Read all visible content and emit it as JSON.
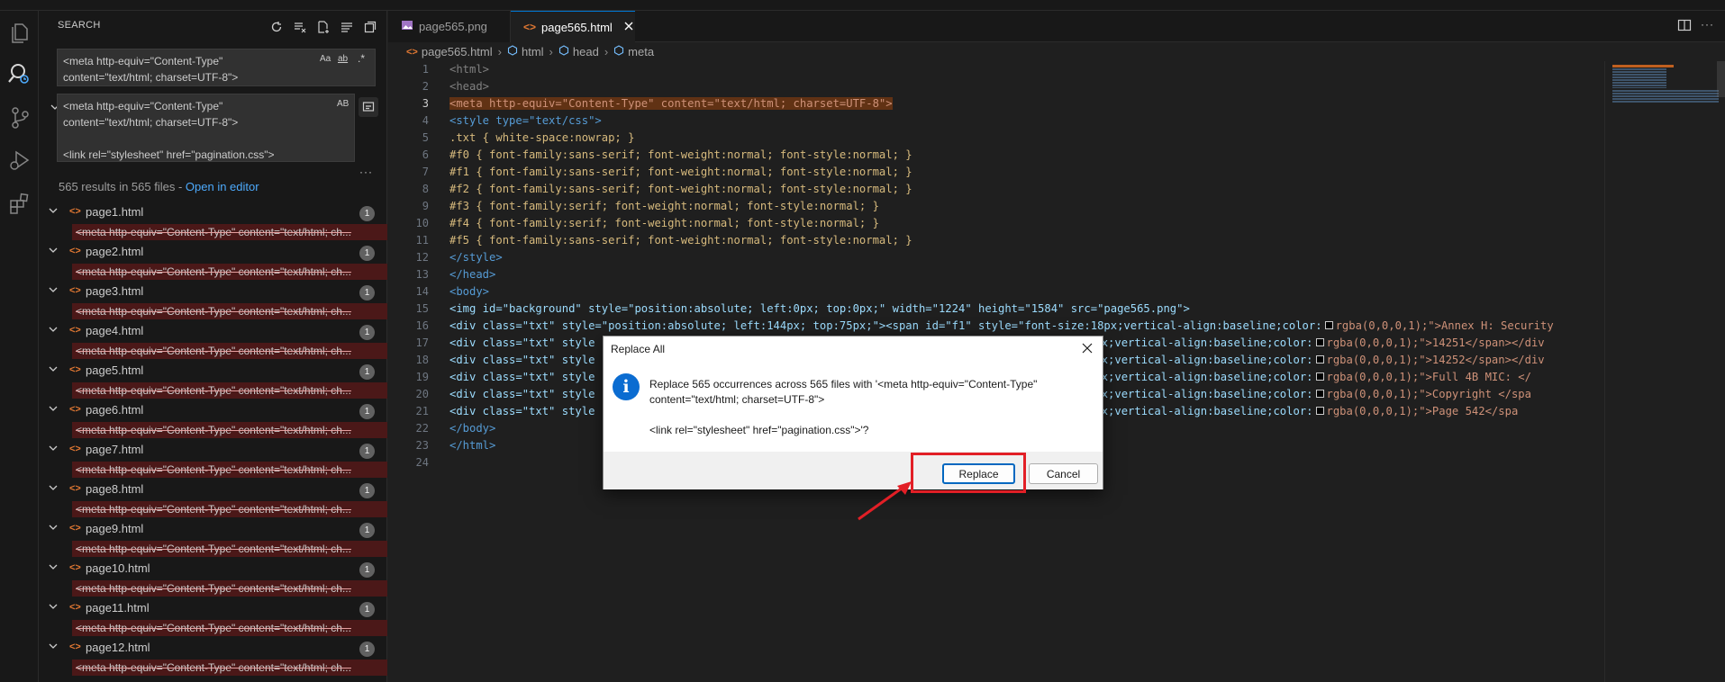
{
  "sidebar": {
    "title": "SEARCH",
    "search_value": "<meta http-equiv=\"Content-Type\"\ncontent=\"text/html; charset=UTF-8\">",
    "opt_case": "Aa",
    "opt_word": "ab",
    "opt_regex": ".*",
    "replace_value": "<meta http-equiv=\"Content-Type\"\ncontent=\"text/html; charset=UTF-8\">\n\n<link rel=\"stylesheet\" href=\"pagination.css\">",
    "opt_preserve": "AB",
    "more": "···",
    "results_summary": "565 results in 565 files - ",
    "open_in_editor": "Open in editor",
    "files": [
      {
        "name": "page1.html",
        "count": "1"
      },
      {
        "name": "page2.html",
        "count": "1"
      },
      {
        "name": "page3.html",
        "count": "1"
      },
      {
        "name": "page4.html",
        "count": "1"
      },
      {
        "name": "page5.html",
        "count": "1"
      },
      {
        "name": "page6.html",
        "count": "1"
      },
      {
        "name": "page7.html",
        "count": "1"
      },
      {
        "name": "page8.html",
        "count": "1"
      },
      {
        "name": "page9.html",
        "count": "1"
      },
      {
        "name": "page10.html",
        "count": "1"
      },
      {
        "name": "page11.html",
        "count": "1"
      },
      {
        "name": "page12.html",
        "count": "1"
      }
    ],
    "match_text": "<meta http-equiv=\"Content-Type\" content=\"text/html; ch..."
  },
  "tabs": [
    {
      "label": "page565.png",
      "active": false
    },
    {
      "label": "page565.html",
      "active": true
    }
  ],
  "breadcrumb": [
    "page565.html",
    "html",
    "head",
    "meta"
  ],
  "editor": {
    "line_numbers": [
      "1",
      "2",
      "3",
      "4",
      "5",
      "6",
      "7",
      "8",
      "9",
      "10",
      "11",
      "12",
      "13",
      "14",
      "15",
      "16",
      "17",
      "18",
      "19",
      "20",
      "21",
      "22",
      "23",
      "24"
    ],
    "current_line": "3",
    "l1": "<html>",
    "l2": "<head>",
    "l3": "<meta http-equiv=\"Content-Type\" content=\"text/html; charset=UTF-8\">",
    "l4": "<style type=\"text/css\">",
    "l5": ".txt { white-space:nowrap; }",
    "l6": "#f0 { font-family:sans-serif; font-weight:normal; font-style:normal; }",
    "l7": "#f1 { font-family:sans-serif; font-weight:normal; font-style:normal; }",
    "l8": "#f2 { font-family:sans-serif; font-weight:normal; font-style:normal; }",
    "l9": "#f3 { font-family:serif; font-weight:normal; font-style:normal; }",
    "l10": "#f4 { font-family:serif; font-weight:normal; font-style:normal; }",
    "l11": "#f5 { font-family:sans-serif; font-weight:normal; font-style:normal; }",
    "l12": "</style>",
    "l13": "</head>",
    "l14": "<body>",
    "l15": "<img id=\"background\" style=\"position:absolute; left:0px; top:0px;\" width=\"1224\" height=\"1584\" src=\"page565.png\">",
    "l16a": "<div class=\"txt\" style=\"position:absolute; left:144px; top:75px;\"><span id=\"f1\" style=\"font-size:18px;vertical-align:baseline;color:",
    "l16b": "rgba(0,0,0,1);\">Annex H: Security",
    "l17a": "<div class=\"txt\" style",
    "l17b": "size:19px;vertical-align:baseline;color:",
    "l17c": "rgba(0,0,0,1);\">14251</span></div",
    "l18a": "<div class=\"txt\" style",
    "l18b": "size:19px;vertical-align:baseline;color:",
    "l18c": "rgba(0,0,0,1);\">14252</span></div",
    "l19a": "<div class=\"txt\" style",
    "l19b": "size:19px;vertical-align:baseline;color:",
    "l19c": "rgba(0,0,0,1);\">Full 4B MIC: </",
    "l20a": "<div class=\"txt\" style",
    "l20b": "size:18px;vertical-align:baseline;color:",
    "l20c": "rgba(0,0,0,1);\">Copyright </spa",
    "l21a": "<div class=\"txt\" style",
    "l21b": "size:18px;vertical-align:baseline;color:",
    "l21c": "rgba(0,0,0,1);\">Page 542</spa",
    "l22": "</body>",
    "l23": "</html>",
    "l24": ""
  },
  "dialog": {
    "title": "Replace All",
    "message": "Replace 565 occurrences across 565 files with '<meta http-equiv=\"Content-Type\"\ncontent=\"text/html; charset=UTF-8\">\n\n<link rel=\"stylesheet\" href=\"pagination.css\">'?",
    "replace_label": "Replace",
    "cancel_label": "Cancel"
  },
  "colors": {
    "accent": "#0078d4",
    "annotation_red": "#e21f26",
    "match_removed_bg": "#4b1818",
    "line_highlight": "#613214"
  },
  "icons": [
    "explorer-icon",
    "search-icon",
    "source-control-icon",
    "run-debug-icon",
    "extensions-icon",
    "refresh-icon",
    "clear-results-icon",
    "new-search-editor-icon",
    "collapse-all-icon",
    "view-as-tree-icon",
    "html-file-icon",
    "image-file-icon",
    "info-icon",
    "close-icon",
    "split-editor-icon",
    "more-actions-icon",
    "replace-all-icon",
    "chevron-down-icon",
    "arrow-icon"
  ]
}
